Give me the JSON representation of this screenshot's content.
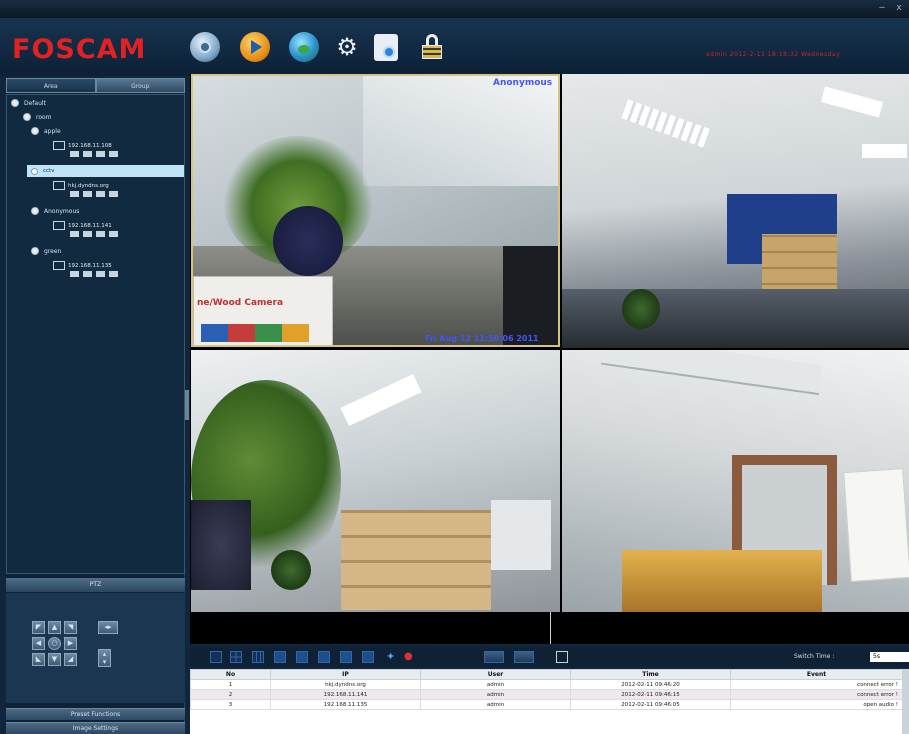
{
  "window": {
    "title": "",
    "minimize": "‒",
    "close": "x"
  },
  "header": {
    "logo": "FOSCAM",
    "toolbar": [
      {
        "name": "live-view-icon",
        "glyph": "◉",
        "color": "#5a9fe0"
      },
      {
        "name": "playback-icon",
        "glyph": "▶",
        "color": "#f0a020"
      },
      {
        "name": "map-icon",
        "glyph": "●",
        "color": "#35b06a"
      },
      {
        "name": "settings-icon",
        "glyph": "⚙",
        "color": "#e8eef3"
      },
      {
        "name": "log-icon",
        "glyph": "▤",
        "color": "#5aa6e8"
      },
      {
        "name": "lock-icon",
        "glyph": "🔒",
        "color": "#e0d9c3"
      }
    ],
    "user_info": "admin   2012-2-11  18:18:32  Wednesday"
  },
  "left_panel": {
    "tabs": [
      "Area",
      "Group"
    ],
    "tree": {
      "default": "Default",
      "room": "room",
      "apple": "apple",
      "cam1": "192.168.11.108",
      "selected": "cctv",
      "cam2": "hkj.dyndns.org",
      "anonymous": "Anonymous",
      "cam3": "192.168.11.141",
      "green": "green",
      "cam4": "192.168.11.135"
    },
    "ptz_label": "PTZ",
    "preset": "Preset Functions",
    "image": "Image Settings"
  },
  "video": {
    "overlay_top": "Anonymous",
    "overlay_sign": "ne/Wood Camera",
    "overlay_bottom": "Fri Aug 12 11:50:06 2011"
  },
  "split_bar": {
    "switch_label": "Switch Time :",
    "switch_value": "5s"
  },
  "events": {
    "headers": [
      "No",
      "IP",
      "User",
      "Time",
      "Event"
    ],
    "rows": [
      [
        "1",
        "hkj.dyndns.org",
        "admin",
        "2012-02-11 09:46:20",
        "connect error !"
      ],
      [
        "2",
        "192.168.11.141",
        "admin",
        "2012-02-11 09:46:15",
        "connect error !"
      ],
      [
        "3",
        "192.168.11.135",
        "admin",
        "2012-02-11 09:46:05",
        "open audio !"
      ]
    ]
  }
}
